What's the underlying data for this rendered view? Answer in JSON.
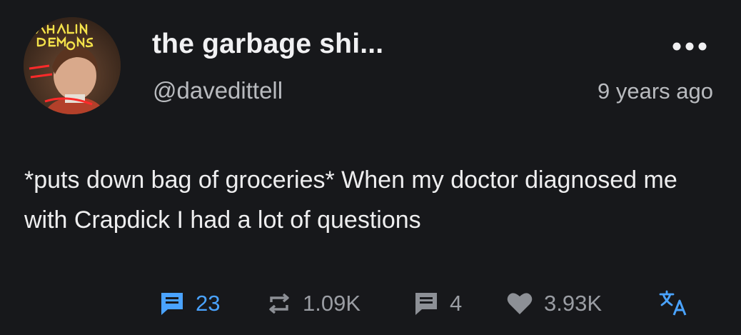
{
  "post": {
    "display_name": "the garbage shi...",
    "handle": "@davedittell",
    "timestamp": "9 years ago",
    "text": "*puts down bag of groceries* When my doctor diagnosed me with Crapdick I had a lot of questions",
    "avatar_scrawl": "VHALIN DEMONS POWERED BY DEMONS"
  },
  "actions": {
    "replies": {
      "icon": "comment-icon",
      "count": "23",
      "color": "#4aa3ff"
    },
    "reblogs": {
      "icon": "repeat-icon",
      "count": "1.09K",
      "color": "#8d9096"
    },
    "notes": {
      "icon": "comment-icon",
      "count": "4",
      "color": "#8d9096"
    },
    "likes": {
      "icon": "heart-icon",
      "count": "3.93K",
      "color": "#8d9096"
    },
    "translate": {
      "icon": "translate-icon",
      "color": "#4aa3ff"
    }
  },
  "menu": {
    "icon": "more-horizontal-icon"
  }
}
